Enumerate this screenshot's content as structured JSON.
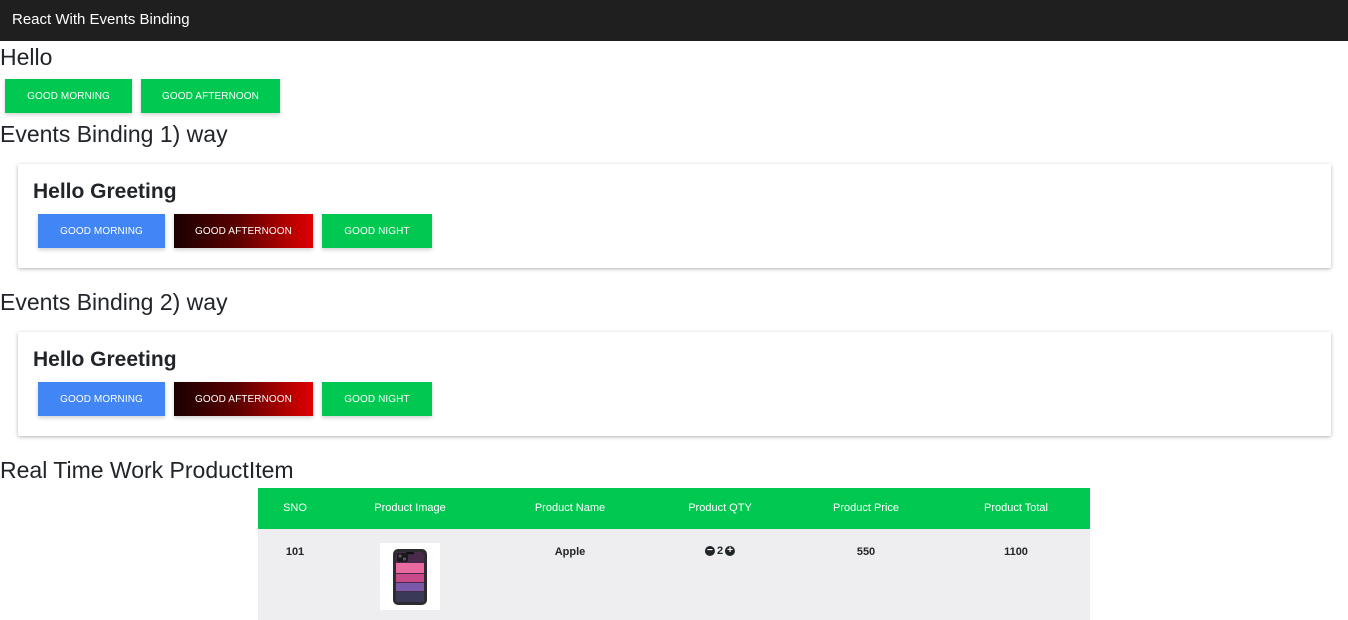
{
  "navbar": {
    "brand": "React With Events Binding"
  },
  "hello_section": {
    "heading": "Hello",
    "buttons": [
      "Good Morning",
      "Good Afternoon"
    ]
  },
  "way1": {
    "heading": "Events Binding 1) way",
    "card_title": "Hello Greeting",
    "buttons": [
      "Good Morning",
      "Good Afternoon",
      "Good Night"
    ]
  },
  "way2": {
    "heading": "Events Binding 2) way",
    "card_title": "Hello Greeting",
    "buttons": [
      "Good Morning",
      "Good Afternoon",
      "Good Night"
    ]
  },
  "products": {
    "heading": "Real Time Work ProductItem",
    "columns": [
      "SNO",
      "Product Image",
      "Product Name",
      "Product QTY",
      "Product Price",
      "Product Total"
    ],
    "rows": [
      {
        "sno": "101",
        "image_icon": "iphone-product-image",
        "name": "Apple",
        "qty": "2",
        "price": "550",
        "total": "1100"
      }
    ]
  },
  "colors": {
    "navbar": "#1f1f1f",
    "green": "#00c851",
    "blue": "#4285f4",
    "dark_red_start": "#1a0000",
    "dark_red_end": "#e00000",
    "table_row": "#eeeef0"
  }
}
